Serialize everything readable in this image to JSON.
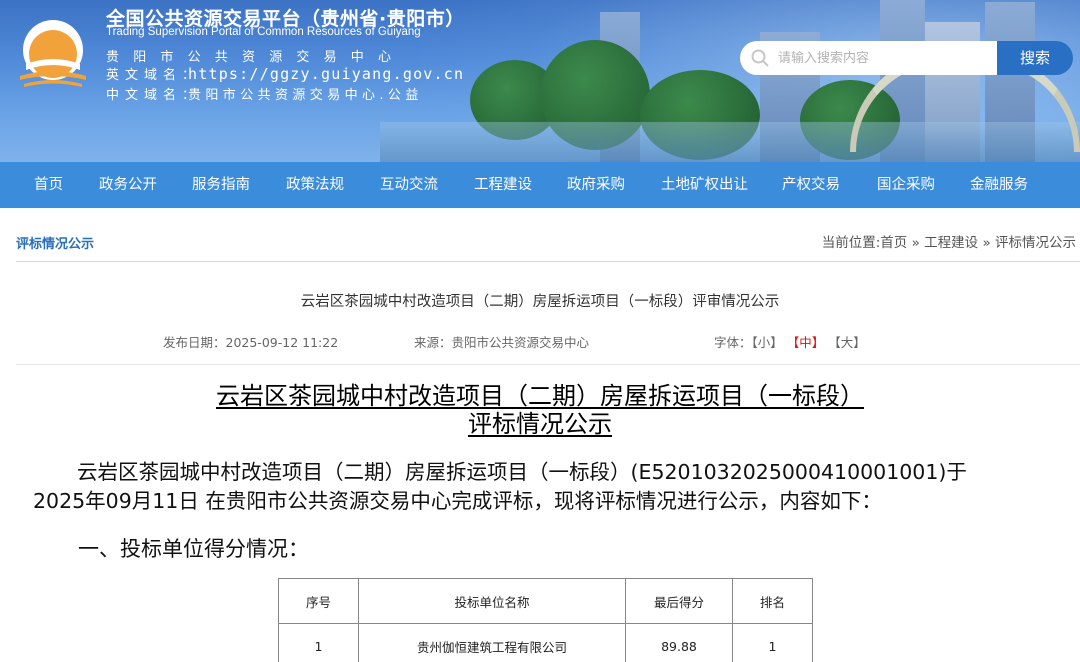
{
  "header": {
    "title": "全国公共资源交易平台（贵州省·贵阳市）",
    "subtitle_en": "Trading Supervision Portal of Common Resources of Guiyang",
    "subtitle_cn": "贵阳市公共资源交易中心",
    "en_domain_label": "英文域名：",
    "en_domain_value": "https://ggzy.guiyang.gov.cn",
    "cn_domain_label": "中文域名：",
    "cn_domain_value": "贵阳市公共资源交易中心.公益",
    "logo_icon": "sun-over-water-logo"
  },
  "search": {
    "placeholder": "请输入搜索内容",
    "button_label": "搜索",
    "icon": "search-icon"
  },
  "nav": {
    "items": [
      "首页",
      "政务公开",
      "服务指南",
      "政策法规",
      "互动交流",
      "工程建设",
      "政府采购",
      "土地矿权出让",
      "产权交易",
      "国企采购",
      "金融服务"
    ]
  },
  "section": {
    "title": "评标情况公示",
    "breadcrumb_prefix": "当前位置:",
    "breadcrumb": [
      "首页",
      "工程建设",
      "评标情况公示"
    ],
    "breadcrumb_sep": "»"
  },
  "article": {
    "title": "云岩区茶园城中村改造项目（二期）房屋拆运项目（一标段）评审情况公示",
    "publish_date": "发布日期：2025-09-12 11:22",
    "source": "来源：贵阳市公共资源交易中心",
    "font_label": "字体：",
    "font_small": "【小】",
    "font_medium": "【中】",
    "font_large": "【大】",
    "doc_heading_line1": "云岩区茶园城中村改造项目（二期）房屋拆运项目（一标段）",
    "doc_heading_line2": "评标情况公示",
    "paragraph_line1": "云岩区茶园城中村改造项目（二期）房屋拆运项目（一标段）(E5201032025000410001001)于",
    "paragraph_line2": "2025年09月11日 在贵阳市公共资源交易中心完成评标，现将评标情况进行公示，内容如下：",
    "section_one": "一、投标单位得分情况：",
    "table": {
      "headers": [
        "序号",
        "投标单位名称",
        "最后得分",
        "排名"
      ],
      "rows": [
        [
          "1",
          "贵州伽恒建筑工程有限公司",
          "89.88",
          "1"
        ]
      ]
    }
  },
  "colors": {
    "nav_bg": "#3b8cdb",
    "accent": "#2a6fb8",
    "highlight_red": "#d11111"
  }
}
